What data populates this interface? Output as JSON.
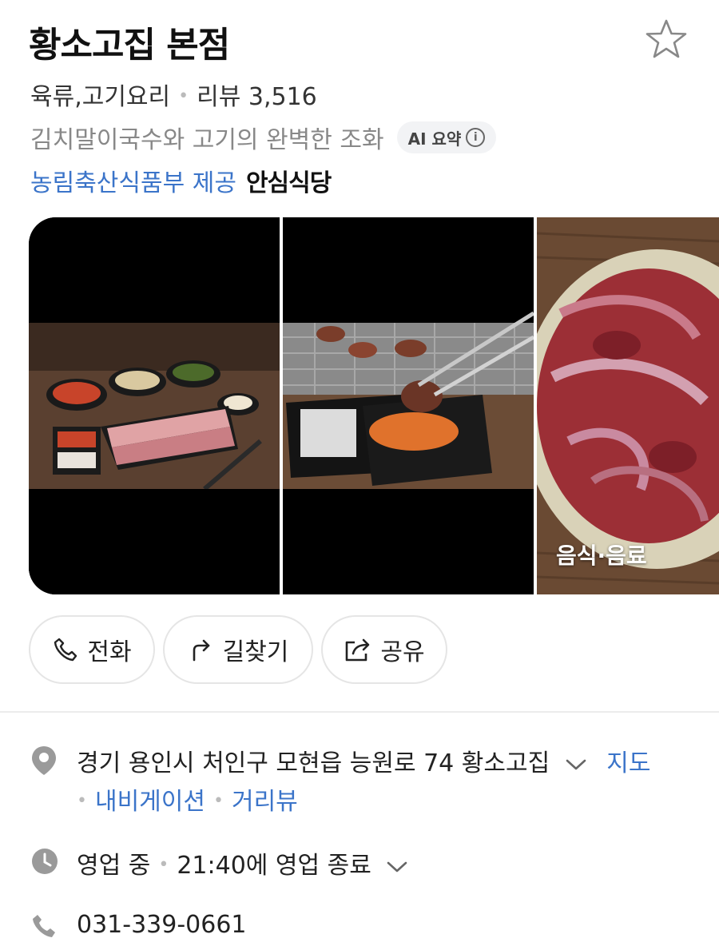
{
  "place": {
    "name": "황소고집 본점",
    "category": "육류,고기요리",
    "review_label": "리뷰 3,516",
    "summary": "김치말이국수와 고기의 완벽한 조화",
    "ai_badge": "AI 요약",
    "provider": "농림축산식품부 제공",
    "safe_label": "안심식당"
  },
  "gallery": {
    "photos": [
      {
        "icon": "pork-belly-set-photo"
      },
      {
        "icon": "grilled-meat-chopsticks-photo"
      },
      {
        "icon": "raw-beef-plate-photo",
        "label": "음식·음료"
      }
    ]
  },
  "actions": {
    "call": "전화",
    "directions": "길찾기",
    "share": "공유"
  },
  "details": {
    "address": "경기 용인시 처인구 모현읍 능원로 74 황소고집",
    "map_link": "지도",
    "navigation_link": "내비게이션",
    "street_view_link": "거리뷰",
    "status": "영업 중",
    "hours": "21:40에 영업 종료",
    "phone": "031-339-0661"
  },
  "colors": {
    "link": "#3b74c9",
    "text": "#111111",
    "muted": "#888888"
  }
}
